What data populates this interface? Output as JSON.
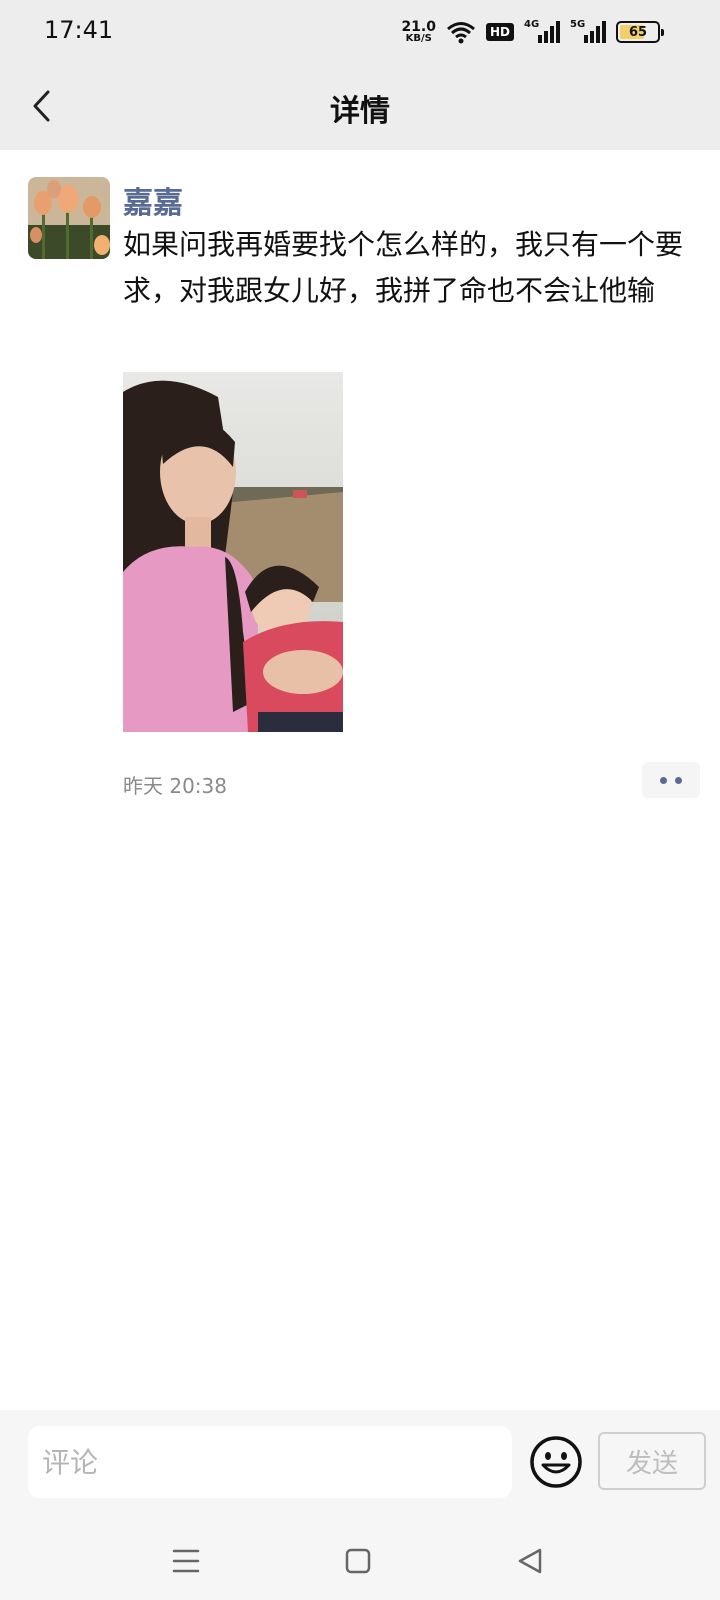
{
  "status_bar": {
    "time": "17:41",
    "net_speed_value": "21.0",
    "net_speed_unit": "KB/S",
    "hd_label": "HD",
    "network_4g": "4G",
    "network_5g": "5G",
    "battery_level": "65"
  },
  "header": {
    "title": "详情",
    "back_icon": "chevron-left-icon"
  },
  "post": {
    "author": "嘉嘉",
    "text": "如果问我再婚要找个怎么样的，我只有一个要求，对我跟女儿好，我拼了命也不会让他输",
    "timestamp": "昨天 20:38",
    "more_icon": "two-dots-icon"
  },
  "comment_bar": {
    "placeholder": "评论",
    "emoji_icon": "smiley-icon",
    "send_label": "发送"
  },
  "system_nav": {
    "menu_icon": "menu-icon",
    "home_icon": "square-home-icon",
    "back_icon": "triangle-back-icon"
  },
  "colors": {
    "link_name": "#576b95",
    "header_bg": "#ededed",
    "battery_fill": "#f2cf6a"
  }
}
